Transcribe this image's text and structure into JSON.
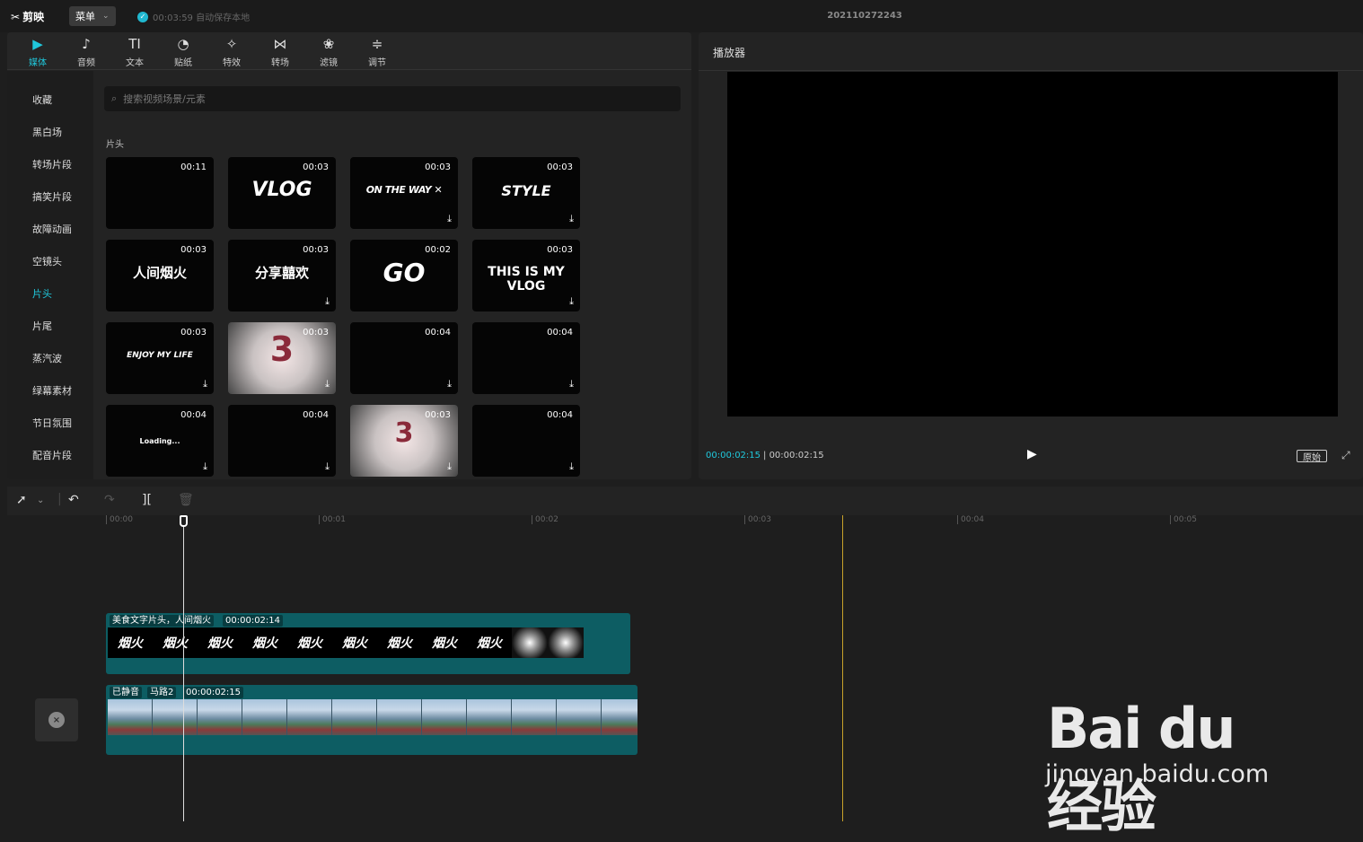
{
  "app": {
    "name": "剪映",
    "menu_label": "菜单",
    "autosave_text": "00:03:59 自动保存本地",
    "project_title": "202110272243"
  },
  "toolbar": [
    {
      "label": "媒体",
      "icon": "media-icon",
      "glyph": "▶",
      "active": true
    },
    {
      "label": "音频",
      "icon": "audio-icon",
      "glyph": "♪"
    },
    {
      "label": "文本",
      "icon": "text-icon",
      "glyph": "TI"
    },
    {
      "label": "贴纸",
      "icon": "sticker-icon",
      "glyph": "◔"
    },
    {
      "label": "特效",
      "icon": "effects-icon",
      "glyph": "✧"
    },
    {
      "label": "转场",
      "icon": "transition-icon",
      "glyph": "⋈"
    },
    {
      "label": "滤镜",
      "icon": "filter-icon",
      "glyph": "❀"
    },
    {
      "label": "调节",
      "icon": "adjust-icon",
      "glyph": "≑"
    }
  ],
  "sidebar": [
    {
      "label": "收藏"
    },
    {
      "label": "黑白场"
    },
    {
      "label": "转场片段"
    },
    {
      "label": "搞笑片段"
    },
    {
      "label": "故障动画"
    },
    {
      "label": "空镜头"
    },
    {
      "label": "片头",
      "active": true
    },
    {
      "label": "片尾"
    },
    {
      "label": "蒸汽波"
    },
    {
      "label": "绿幕素材"
    },
    {
      "label": "节日氛围"
    },
    {
      "label": "配音片段"
    }
  ],
  "search": {
    "placeholder": "搜索视频场景/元素"
  },
  "section_title": "片头",
  "thumbnails": [
    {
      "duration": "00:11",
      "text": "",
      "download": false
    },
    {
      "duration": "00:03",
      "text": "VLOG",
      "download": false
    },
    {
      "duration": "00:03",
      "text": "ON THE WAY ✕",
      "download": true
    },
    {
      "duration": "00:03",
      "text": "STYLE",
      "download": true
    },
    {
      "duration": "00:03",
      "text": "人间烟火",
      "download": false
    },
    {
      "duration": "00:03",
      "text": "分享囍欢",
      "download": true
    },
    {
      "duration": "00:02",
      "text": "GO",
      "download": false
    },
    {
      "duration": "00:03",
      "text": "THIS IS MY VLOG",
      "download": true
    },
    {
      "duration": "00:03",
      "text": "ENJOY MY LIFE",
      "download": true
    },
    {
      "duration": "00:03",
      "text": "3",
      "download": true
    },
    {
      "duration": "00:04",
      "text": "",
      "download": true
    },
    {
      "duration": "00:04",
      "text": "",
      "download": true
    },
    {
      "duration": "00:04",
      "text": "Loading...",
      "download": true
    },
    {
      "duration": "00:04",
      "text": "",
      "download": true
    },
    {
      "duration": "00:03",
      "text": "3",
      "download": true
    },
    {
      "duration": "00:04",
      "text": "",
      "download": true
    }
  ],
  "player": {
    "title": "播放器",
    "current_time": "00:00:02:15",
    "total_time": "00:00:02:15",
    "original_label": "原始"
  },
  "timeline": {
    "ruler": [
      "00:00",
      "00:01",
      "00:02",
      "00:03",
      "00:04",
      "00:05"
    ],
    "clip_text": {
      "name": "美食文字片头，人间烟火",
      "duration": "00:00:02:14",
      "frame_text": "烟火"
    },
    "clip_video": {
      "muted_label": "已静音",
      "name": "马路2",
      "duration": "00:00:02:15"
    }
  },
  "watermark": {
    "logo": "Bai du 经验",
    "url": "jingyan.baidu.com"
  }
}
